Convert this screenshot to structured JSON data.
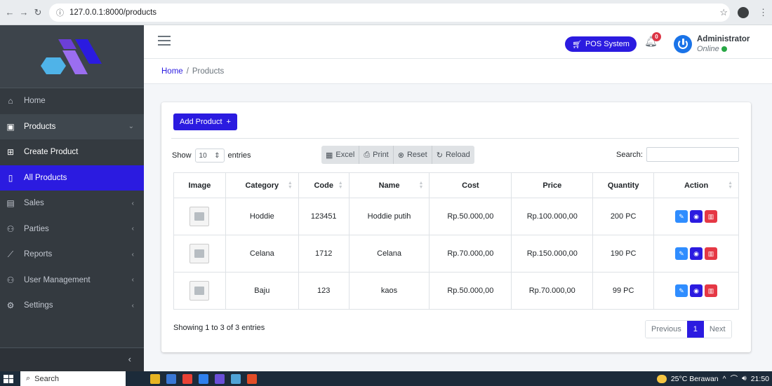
{
  "browser": {
    "url": "127.0.0.1:8000/products"
  },
  "sidebar": {
    "items": [
      {
        "label": "Home",
        "icon": "home-icon"
      },
      {
        "label": "Products",
        "icon": "box-icon"
      },
      {
        "label": "Create Product",
        "icon": "plus-square-icon"
      },
      {
        "label": "All Products",
        "icon": "file-icon"
      },
      {
        "label": "Sales",
        "icon": "receipt-icon"
      },
      {
        "label": "Parties",
        "icon": "users-icon"
      },
      {
        "label": "Reports",
        "icon": "chart-line-icon"
      },
      {
        "label": "User Management",
        "icon": "user-group-icon"
      },
      {
        "label": "Settings",
        "icon": "gear-icon"
      }
    ],
    "collapse_glyph": "‹"
  },
  "topbar": {
    "pos_label": "POS System",
    "notification_count": "0",
    "user_name": "Administrator",
    "user_status": "Online"
  },
  "breadcrumb": {
    "home": "Home",
    "separator": "/",
    "current": "Products"
  },
  "card": {
    "add_button": "Add Product",
    "show_label": "Show",
    "entries_value": "10",
    "entries_label": "entries",
    "buttons": {
      "excel": "Excel",
      "print": "Print",
      "reset": "Reset",
      "reload": "Reload"
    },
    "search_label": "Search:"
  },
  "table": {
    "headers": [
      "Image",
      "Category",
      "Code",
      "Name",
      "Cost",
      "Price",
      "Quantity",
      "Action"
    ],
    "rows": [
      {
        "category": "Hoddie",
        "code": "123451",
        "name": "Hoddie putih",
        "cost": "Rp.50.000,00",
        "price": "Rp.100.000,00",
        "quantity": "200 PC"
      },
      {
        "category": "Celana",
        "code": "1712",
        "name": "Celana",
        "cost": "Rp.70.000,00",
        "price": "Rp.150.000,00",
        "quantity": "190 PC"
      },
      {
        "category": "Baju",
        "code": "123",
        "name": "kaos",
        "cost": "Rp.50.000,00",
        "price": "Rp.70.000,00",
        "quantity": "99 PC"
      }
    ]
  },
  "footer": {
    "showing": "Showing 1 to 3 of 3 entries",
    "previous": "Previous",
    "page": "1",
    "next": "Next"
  },
  "taskbar": {
    "search": "Search",
    "weather": "25°C Berawan",
    "time": "21:50"
  },
  "colors": {
    "accent": "#2b1be0",
    "sidebar": "#343a40",
    "danger": "#e53845",
    "info": "#2f8dff",
    "online": "#28a745"
  }
}
